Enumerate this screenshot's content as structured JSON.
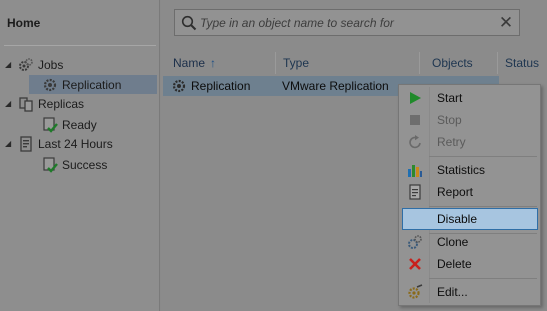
{
  "left_panel": {
    "home_label": "Home",
    "tree": [
      {
        "label": "Jobs",
        "level": 0,
        "expanded": true,
        "icon": "jobs-gear-icon"
      },
      {
        "label": "Replication",
        "level": 1,
        "selected": true,
        "icon": "replication-gear-icon"
      },
      {
        "label": "Replicas",
        "level": 0,
        "expanded": true,
        "icon": "replicas-icon"
      },
      {
        "label": "Ready",
        "level": 1,
        "icon": "ready-check-icon"
      },
      {
        "label": "Last 24 Hours",
        "level": 0,
        "expanded": true,
        "icon": "last24-icon"
      },
      {
        "label": "Success",
        "level": 1,
        "icon": "success-check-icon"
      }
    ]
  },
  "search": {
    "placeholder": "Type in an object name to search for",
    "clear_glyph": "✕"
  },
  "table": {
    "columns": [
      {
        "label": "Name",
        "sort_indicator": "↑"
      },
      {
        "label": "Type"
      },
      {
        "label": "Objects"
      },
      {
        "label": "Status"
      }
    ],
    "rows": [
      {
        "name": "Replication",
        "type": "VMware Replication"
      }
    ]
  },
  "context_menu": {
    "items": [
      {
        "label": "Start",
        "icon": "play-icon",
        "disabled": false
      },
      {
        "label": "Stop",
        "icon": "stop-icon",
        "disabled": true
      },
      {
        "label": "Retry",
        "icon": "retry-icon",
        "disabled": true
      },
      {
        "label": "Statistics",
        "icon": "statistics-icon",
        "disabled": false
      },
      {
        "label": "Report",
        "icon": "report-icon",
        "disabled": false
      },
      {
        "label": "Disable",
        "icon": "",
        "disabled": false,
        "highlighted": true
      },
      {
        "label": "Clone",
        "icon": "clone-icon",
        "disabled": false
      },
      {
        "label": "Delete",
        "icon": "delete-icon",
        "disabled": false
      },
      {
        "label": "Edit...",
        "icon": "edit-icon",
        "disabled": false
      }
    ]
  },
  "colors": {
    "overlay_dim": "#8b8b8b",
    "menu_highlight": "#a7c5e0",
    "menu_highlight_border": "#2f6ea6",
    "selected_row": "#6e808f",
    "play_green": "#1f8a2a",
    "delete_red": "#c8201c"
  }
}
